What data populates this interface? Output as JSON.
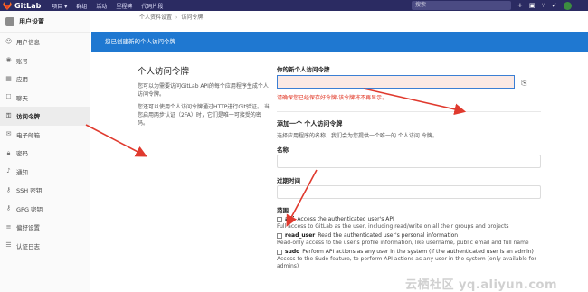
{
  "topbar": {
    "brand": "GitLab",
    "nav": [
      "项目 ▾",
      "群组",
      "活动",
      "里程碑",
      "代码片段"
    ],
    "search_placeholder": "搜索",
    "icons": [
      "plus-icon",
      "issues-icon",
      "merge-request-icon",
      "todo-icon"
    ]
  },
  "sidebar": {
    "title": "用户设置",
    "items": [
      {
        "label": "用户信息",
        "icon": "user-icon",
        "active": false
      },
      {
        "label": "账号",
        "icon": "account-icon",
        "active": false
      },
      {
        "label": "应用",
        "icon": "applications-icon",
        "active": false
      },
      {
        "label": "聊天",
        "icon": "chat-icon",
        "active": false
      },
      {
        "label": "访问令牌",
        "icon": "token-icon",
        "active": true
      },
      {
        "label": "电子邮箱",
        "icon": "email-icon",
        "active": false
      },
      {
        "label": "密码",
        "icon": "lock-icon",
        "active": false
      },
      {
        "label": "通知",
        "icon": "bell-icon",
        "active": false
      },
      {
        "label": "SSH 密钥",
        "icon": "key-icon",
        "active": false
      },
      {
        "label": "GPG 密钥",
        "icon": "key-icon",
        "active": false
      },
      {
        "label": "偏好设置",
        "icon": "preferences-icon",
        "active": false
      },
      {
        "label": "认证日志",
        "icon": "log-icon",
        "active": false
      }
    ]
  },
  "breadcrumb": {
    "parent": "个人资料设置",
    "current": "访问令牌"
  },
  "banner": {
    "text": "您已创建新的个人访问令牌"
  },
  "intro": {
    "title": "个人访问令牌",
    "p1": "您可以为需要访问GitLab API的每个应用程序生成个人访问令牌。",
    "p2": "您还可以使用个人访问令牌通过HTTP进行Git验证。 当您启用两步认证（2FA）时，它们是唯一可接受的密码。"
  },
  "token": {
    "label": "你的新个人访问令牌",
    "value": "",
    "warning": "请确保您已经保存好令牌-该令牌将不再显示。"
  },
  "form": {
    "heading": "添加一个 个人访问令牌",
    "subheading": "选择应用程序的名称，我们会为您提供一个唯一的 个人访问 令牌。",
    "name_label": "名称",
    "expires_label": "过期时间",
    "scopes_label": "范围",
    "scopes": [
      {
        "name": "api",
        "desc_inline": "Access the authenticated user's API",
        "desc_below": "Full access to GitLab as the user, including read/write on all their groups and projects"
      },
      {
        "name": "read_user",
        "desc_inline": "Read the authenticated user's personal information",
        "desc_below": "Read-only access to the user's profile information, like username, public email and full name"
      },
      {
        "name": "sudo",
        "desc_inline": "Perform API actions as any user in the system (if the authenticated user is an admin)",
        "desc_below": "Access to the Sudo feature, to perform API actions as any user in the system (only available for admins)"
      }
    ]
  },
  "watermark": "云栖社区 yq.aliyun.com",
  "colors": {
    "navbar": "#2b2b62",
    "banner": "#1f78d1",
    "warning": "#e0301e",
    "arrow": "#e03a2e"
  }
}
